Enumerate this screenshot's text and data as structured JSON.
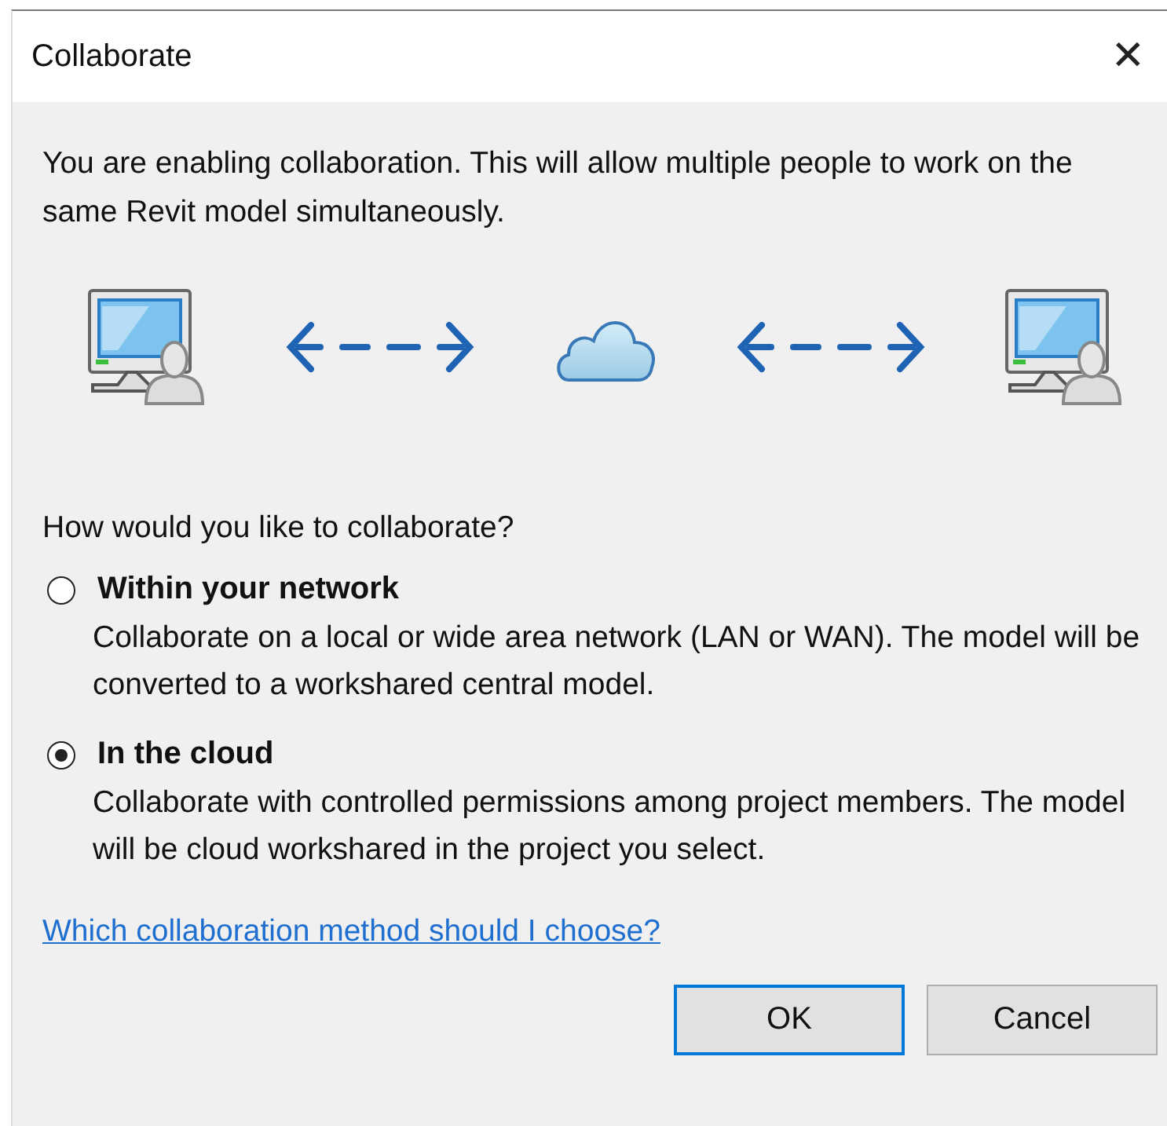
{
  "window": {
    "title": "Collaborate",
    "close": "✕"
  },
  "intro": "You are enabling collaboration. This will allow multiple people to work on the same Revit model simultaneously.",
  "question": "How would you like to collaborate?",
  "options": [
    {
      "label": "Within your network",
      "description": "Collaborate on a local or wide area network (LAN or WAN). The model will be converted to a workshared central model.",
      "selected": false
    },
    {
      "label": "In the cloud",
      "description": "Collaborate with controlled permissions among project members. The model will be cloud workshared in the project you select.",
      "selected": true
    }
  ],
  "help_link": "Which collaboration method should I choose?",
  "buttons": [
    {
      "label": "OK",
      "focused": true
    },
    {
      "label": "Cancel",
      "focused": false
    }
  ]
}
